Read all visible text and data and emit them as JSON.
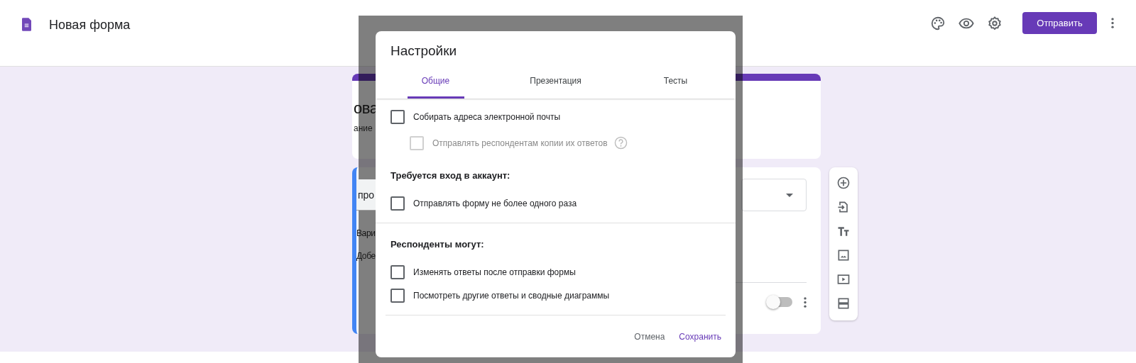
{
  "header": {
    "title": "Новая форма",
    "send_button": "Отправить"
  },
  "form": {
    "title_fragment": "ова",
    "description_fragment": "ание",
    "question": {
      "title_fragment": "про",
      "option_fragment": "Вари",
      "add_option_fragment": "Добе",
      "required_on": false
    }
  },
  "dialog": {
    "title": "Настройки",
    "tabs": [
      {
        "label": "Общие",
        "selected": true
      },
      {
        "label": "Презентация",
        "selected": false
      },
      {
        "label": "Тесты",
        "selected": false
      }
    ],
    "sections": [
      {
        "items": [
          {
            "label": "Собирать адреса электронной почты",
            "checked": false,
            "disabled": false,
            "children": [
              {
                "label": "Отправлять респондентам копии их ответов",
                "checked": false,
                "disabled": true,
                "help": true
              }
            ]
          }
        ]
      },
      {
        "heading": "Требуется вход в аккаунт:",
        "items": [
          {
            "label": "Отправлять форму не более одного раза",
            "checked": false,
            "disabled": false
          }
        ]
      },
      {
        "divider_above": true,
        "heading": "Респонденты могут:",
        "items": [
          {
            "label": "Изменять ответы после отправки формы",
            "checked": false,
            "disabled": false
          },
          {
            "label": "Посмотреть другие ответы и сводные диаграммы",
            "checked": false,
            "disabled": false
          }
        ]
      }
    ],
    "actions": [
      {
        "label": "Отмена",
        "kind": "secondary"
      },
      {
        "label": "Сохранить",
        "kind": "primary"
      }
    ]
  }
}
